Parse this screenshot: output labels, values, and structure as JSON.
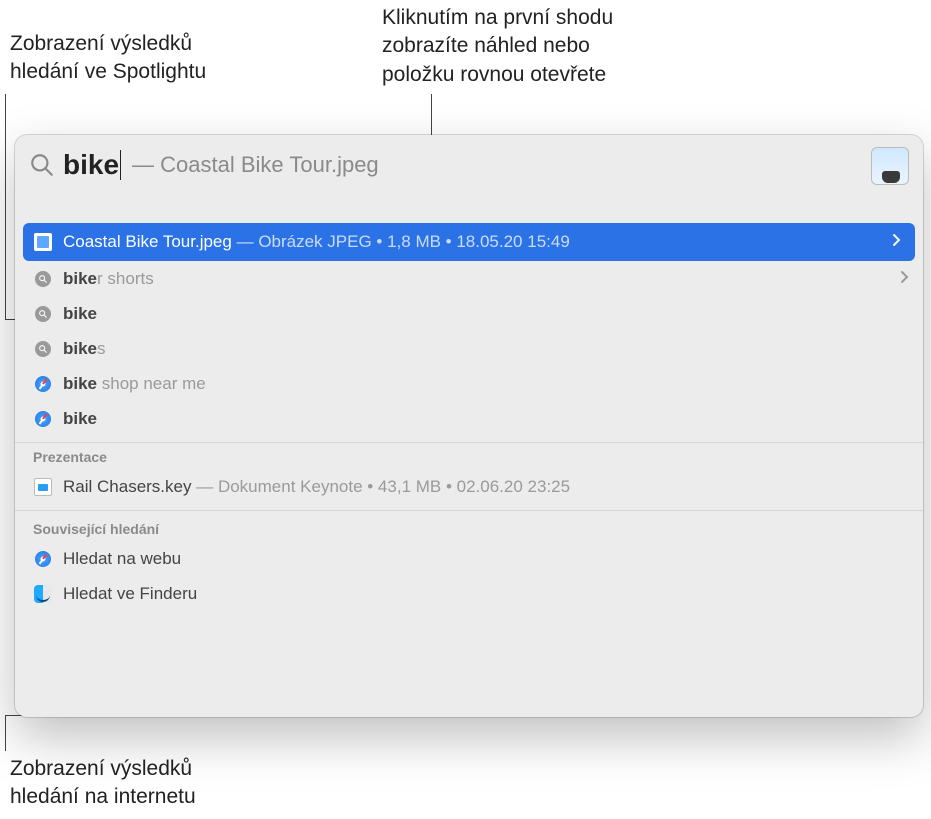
{
  "callouts": {
    "topLeft": "Zobrazení výsledků\nhledání ve Spotlightu",
    "topRight": "Kliknutím na první shodu\nzobrazíte náhled nebo\npoložku rovnou otevřete",
    "bottom": "Zobrazení výsledků\nhledání na internetu"
  },
  "search": {
    "query": "bike",
    "completionDash": "—",
    "completion": "Coastal Bike Tour.jpeg"
  },
  "topHit": {
    "title": "Coastal Bike Tour.jpeg",
    "sep": " — ",
    "meta": "Obrázek JPEG • 1,8 MB • 18.05.20 15:49"
  },
  "suggestions": [
    {
      "iconType": "search",
      "bold": "bike",
      "rest": "r shorts",
      "chevron": true
    },
    {
      "iconType": "search",
      "bold": "bike",
      "rest": ""
    },
    {
      "iconType": "search",
      "bold": "bike",
      "rest": "s"
    },
    {
      "iconType": "safari",
      "bold": "bike",
      "rest": " shop near me"
    },
    {
      "iconType": "safari",
      "bold": "bike",
      "rest": ""
    }
  ],
  "sections": {
    "presentations": {
      "heading": "Prezentace",
      "item": {
        "title": "Rail Chasers.key",
        "sep": " — ",
        "meta": "Dokument Keynote • 43,1 MB • 02.06.20 23:25"
      }
    },
    "related": {
      "heading": "Související hledání",
      "items": [
        {
          "iconType": "safari",
          "label": "Hledat na webu"
        },
        {
          "iconType": "finder",
          "label": "Hledat ve Finderu"
        }
      ]
    }
  }
}
